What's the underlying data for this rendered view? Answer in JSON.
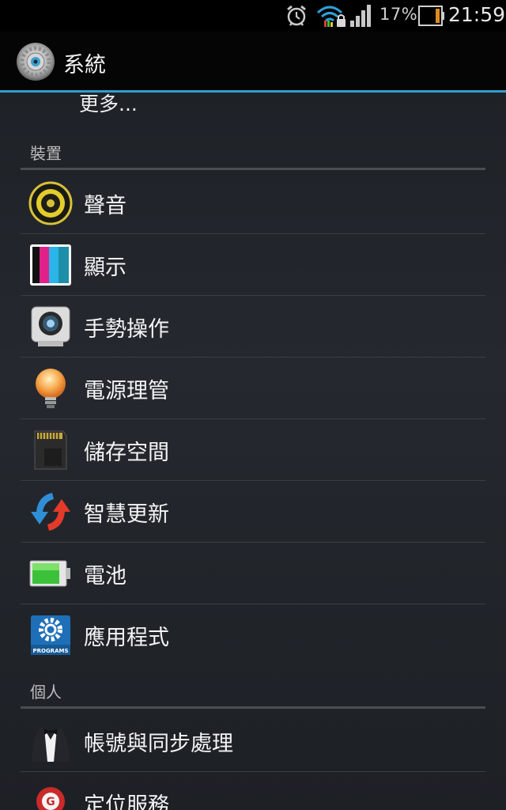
{
  "status_bar": {
    "battery_percent": "17%",
    "time": "21:59",
    "icons": [
      "alarm-icon",
      "wifi-locked-icon",
      "signal-icon",
      "battery-icon"
    ]
  },
  "action_bar": {
    "title": "系統",
    "icon": "settings-gear-icon"
  },
  "more_label": "更多...",
  "sections": [
    {
      "header": "裝置",
      "items": [
        {
          "label": "聲音",
          "icon": "speaker-icon"
        },
        {
          "label": "顯示",
          "icon": "display-icon"
        },
        {
          "label": "手勢操作",
          "icon": "gesture-camera-icon"
        },
        {
          "label": "電源理管",
          "icon": "lightbulb-icon"
        },
        {
          "label": "儲存空間",
          "icon": "sd-card-icon"
        },
        {
          "label": "智慧更新",
          "icon": "update-arrows-icon"
        },
        {
          "label": "電池",
          "icon": "battery-icon"
        },
        {
          "label": "應用程式",
          "icon": "programs-icon"
        }
      ]
    },
    {
      "header": "個人",
      "items": [
        {
          "label": "帳號與同步處理",
          "icon": "tuxedo-icon"
        },
        {
          "label": "定位服務",
          "icon": "location-pin-icon"
        }
      ]
    }
  ]
}
